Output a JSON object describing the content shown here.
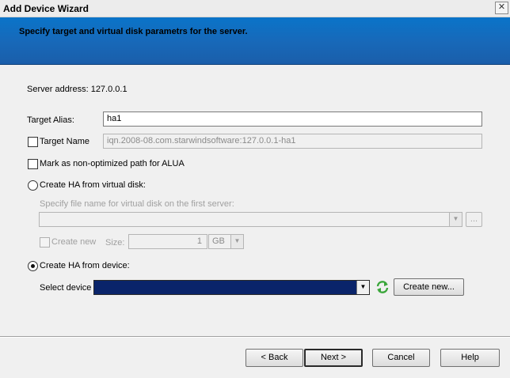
{
  "window": {
    "title": "Add Device Wizard",
    "close_glyph": "✕"
  },
  "banner": {
    "text": "Specify target and virtual disk parametrs for the server."
  },
  "server": {
    "label": "Server address: 127.0.0.1"
  },
  "target_alias": {
    "label": "Target Alias:",
    "value": "ha1"
  },
  "target_name": {
    "label": "Target Name",
    "value": "iqn.2008-08.com.starwindsoftware:127.0.0.1-ha1",
    "checked": false
  },
  "alua": {
    "label": "Mark as non-optimized path for ALUA",
    "checked": false
  },
  "ha_virtual_disk": {
    "label": "Create HA from virtual disk:",
    "selected": false,
    "file_label": "Specify file name for virtual disk on the first server:",
    "browse_label": "...",
    "create_new_label": "Create new",
    "size_label": "Size:",
    "size_value": "1",
    "size_unit": "GB"
  },
  "ha_device": {
    "label": "Create HA from device:",
    "selected": true,
    "select_device_label": "Select device",
    "create_new_button": "Create new...",
    "refresh_icon": "refresh-icon"
  },
  "footer": {
    "back": "< Back",
    "next": "Next >",
    "cancel": "Cancel",
    "help": "Help"
  },
  "colors": {
    "banner_top": "#0a74c9",
    "banner_bottom": "#1a5eaa",
    "selected_combo": "#0a246a",
    "refresh_green": "#3aa63a"
  }
}
